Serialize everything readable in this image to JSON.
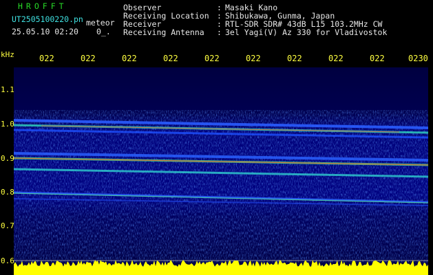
{
  "header": {
    "program": "HROFFT",
    "filename": "UT2505100220.pn",
    "meteor_label": "meteor",
    "datetime": "25.05.10 02:20",
    "count": "0_."
  },
  "info": [
    {
      "label": "Observer",
      "value": "Masaki Kano"
    },
    {
      "label": "Receiving Location",
      "value": "Shibukawa, Gunma, Japan"
    },
    {
      "label": "Receiver",
      "value": "RTL-SDR SDR# 43dB L15 103.2MHz CW"
    },
    {
      "label": "Receiving Antenna",
      "value": "3el Yagi(V) Az 330 for Vladivostok"
    }
  ],
  "axis": {
    "y_unit": "kHz",
    "y_ticks": [
      "1.1",
      "1.0",
      "0.9",
      "0.8",
      "0.7",
      "0.6"
    ],
    "x_ticks": [
      "022",
      "022",
      "022",
      "022",
      "022",
      "022",
      "022",
      "022",
      "022",
      "0230"
    ]
  },
  "colors": {
    "background": "#000000",
    "spectrogram_bg": "#00006e",
    "signal_low": "#1e50ff",
    "signal_mid": "#28e6a0",
    "signal_high": "#ff3c1e",
    "level_bar": "#ffff00"
  }
}
